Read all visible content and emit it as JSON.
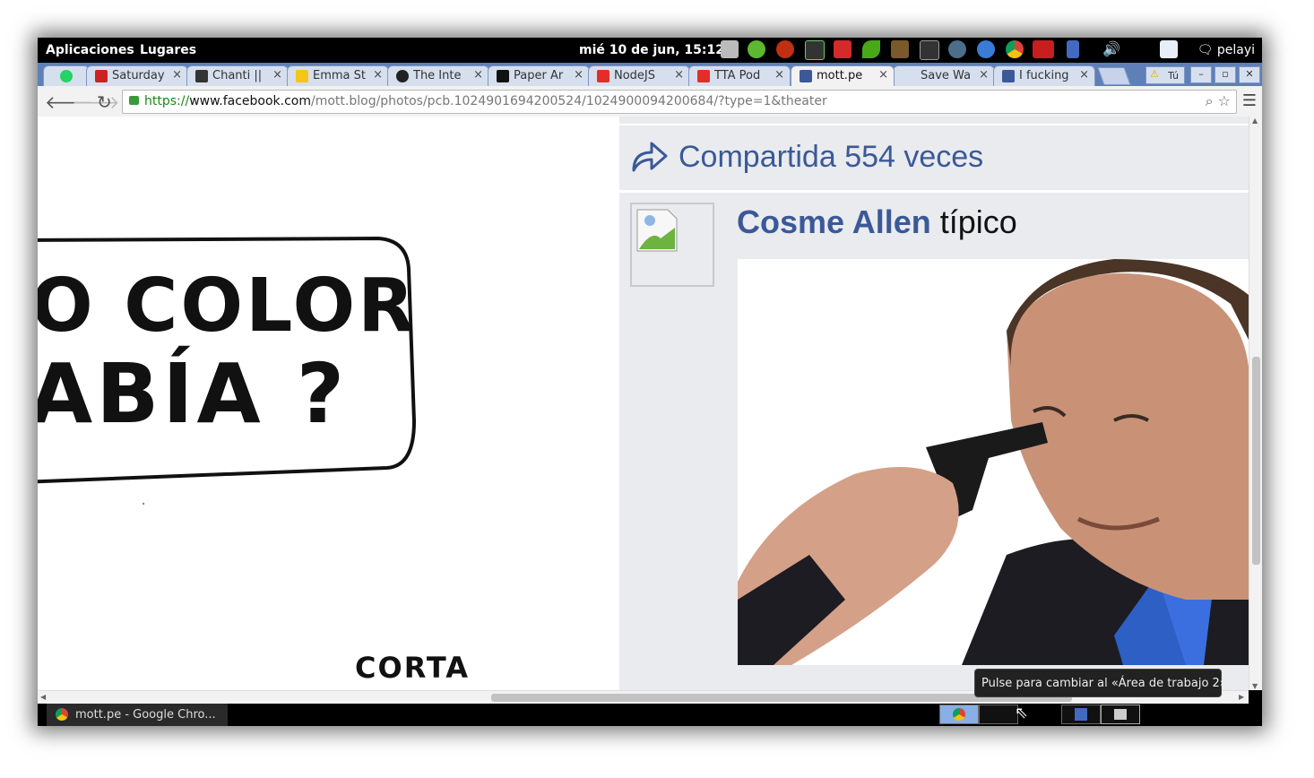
{
  "panel": {
    "applications": "Aplicaciones",
    "places": "Lugares",
    "clock": "mié 10 de jun, 15:12",
    "user": "pelayi"
  },
  "tabs": [
    {
      "label": "",
      "icon": "whatsapp-icon",
      "color": "#25d366"
    },
    {
      "label": "Saturday",
      "icon": "smiley-icon",
      "color": "#cc2222"
    },
    {
      "label": "Chanti ||",
      "icon": "panda-icon",
      "color": "#333333"
    },
    {
      "label": "Emma St",
      "icon": "imdb-icon",
      "color": "#f5c518"
    },
    {
      "label": "The Inte",
      "icon": "github-icon",
      "color": "#222222"
    },
    {
      "label": "Paper Ar",
      "icon": "t-icon",
      "color": "#111111"
    },
    {
      "label": "NodeJS",
      "icon": "youtube-icon",
      "color": "#e52d27"
    },
    {
      "label": "TTA Pod",
      "icon": "youtube-icon",
      "color": "#e52d27"
    },
    {
      "label": "mott.pe",
      "icon": "facebook-icon",
      "color": "#3b5998"
    },
    {
      "label": "Save Wa",
      "icon": "blank-icon",
      "color": "#d6dfee"
    },
    {
      "label": "I fucking",
      "icon": "facebook-icon",
      "color": "#3b5998"
    }
  ],
  "tab_close": "×",
  "warning_badge": "Tú",
  "window_controls": {
    "minimize": "–",
    "restore": "▫",
    "close": "✕"
  },
  "toolbar": {
    "url_scheme": "https://",
    "url_host": "www.facebook.com",
    "url_path": "/mott.blog/photos/pcb.1024901694200524/1024900094200684/?type=1&theater"
  },
  "left_comic": {
    "line1": "O COLOR",
    "line2": "ABÍA ?",
    "footer": "CORTA"
  },
  "share": {
    "text": "Compartida 554 veces"
  },
  "comment": {
    "author": "Cosme Allen",
    "text": "típico"
  },
  "taskbar": {
    "window_title": "mott.pe - Google Chro..."
  },
  "tooltip": {
    "text": "Pulse para cambiar al «Área de trabajo 2»"
  }
}
